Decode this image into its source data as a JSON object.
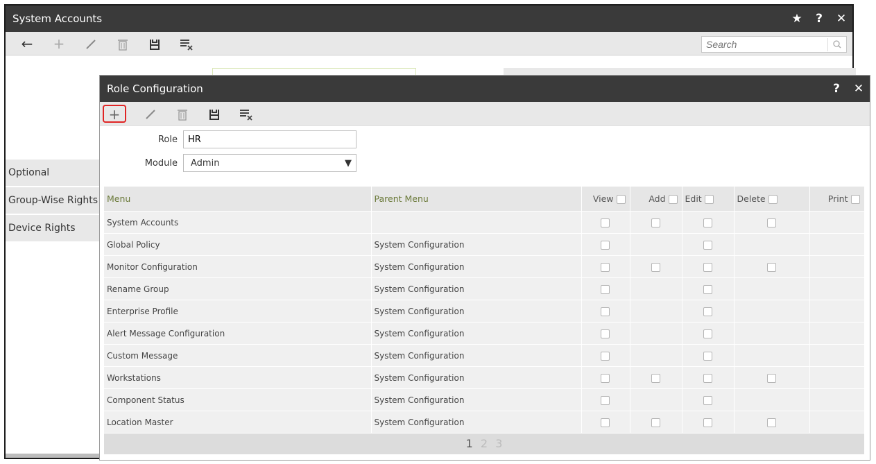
{
  "outer": {
    "title": "System Accounts",
    "search_placeholder": "Search",
    "left_tabs": [
      "Optional",
      "Group-Wise Rights",
      "Device Rights"
    ]
  },
  "dialog": {
    "title": "Role Configuration",
    "role_label": "Role",
    "role_value": "HR",
    "module_label": "Module",
    "module_value": "Admin",
    "columns": {
      "menu": "Menu",
      "parent": "Parent Menu",
      "view": "View",
      "add": "Add",
      "edit": "Edit",
      "delete": "Delete",
      "print": "Print"
    },
    "rows": [
      {
        "menu": "System Accounts",
        "parent": "",
        "view": true,
        "add": true,
        "edit": true,
        "delete": true,
        "print": false
      },
      {
        "menu": "Global Policy",
        "parent": "System Configuration",
        "view": true,
        "add": false,
        "edit": true,
        "delete": false,
        "print": false
      },
      {
        "menu": "Monitor Configuration",
        "parent": "System Configuration",
        "view": true,
        "add": true,
        "edit": true,
        "delete": true,
        "print": false
      },
      {
        "menu": "Rename Group",
        "parent": "System Configuration",
        "view": true,
        "add": false,
        "edit": true,
        "delete": false,
        "print": false
      },
      {
        "menu": "Enterprise Profile",
        "parent": "System Configuration",
        "view": true,
        "add": false,
        "edit": true,
        "delete": false,
        "print": false
      },
      {
        "menu": "Alert Message Configuration",
        "parent": "System Configuration",
        "view": true,
        "add": false,
        "edit": true,
        "delete": false,
        "print": false
      },
      {
        "menu": "Custom Message",
        "parent": "System Configuration",
        "view": true,
        "add": false,
        "edit": true,
        "delete": false,
        "print": false
      },
      {
        "menu": "Workstations",
        "parent": "System Configuration",
        "view": true,
        "add": true,
        "edit": true,
        "delete": true,
        "print": false
      },
      {
        "menu": "Component Status",
        "parent": "System Configuration",
        "view": true,
        "add": false,
        "edit": true,
        "delete": false,
        "print": false
      },
      {
        "menu": "Location Master",
        "parent": "System Configuration",
        "view": true,
        "add": true,
        "edit": true,
        "delete": true,
        "print": false
      }
    ],
    "pages": [
      "1",
      "2",
      "3"
    ],
    "active_page": "1"
  },
  "icons": {
    "star": "star-icon",
    "help": "help-icon",
    "close": "close-icon",
    "back": "back-arrow-icon",
    "add": "plus-icon",
    "edit": "pencil-icon",
    "delete": "trash-icon",
    "save": "save-icon",
    "clear": "clear-list-icon",
    "search": "search-icon"
  },
  "colors": {
    "titlebar": "#3a3a3a",
    "toolbar": "#e8e8e8",
    "highlight": "#e02424",
    "header_text": "#6b7a3a"
  }
}
